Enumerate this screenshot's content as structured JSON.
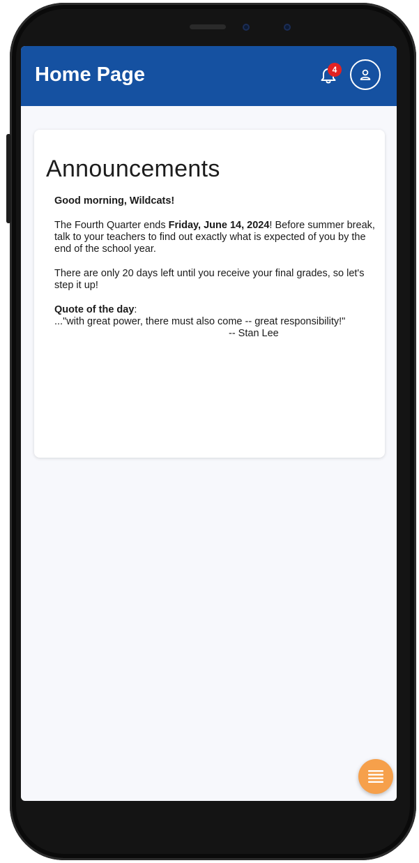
{
  "header": {
    "title": "Home Page",
    "notification_count": "4",
    "bell_icon": "bell-icon",
    "avatar_icon": "user-icon",
    "color": "#1551a1"
  },
  "announcements": {
    "title": "Announcements",
    "greeting": "Good morning, Wildcats!",
    "para1": {
      "before": "The Fourth Quarter ends ",
      "date": "Friday, June 14, 2024",
      "after": "! Before summer break, talk to your teachers to find out exactly what is expected of you by the end of the school year."
    },
    "para2": "There are only 20 days left until you receive your final grades, so let's step it up!",
    "quote": {
      "label": "Quote of the day",
      "separator": ":",
      "text": "...\"with great power, there must also come -- great responsibility!\"",
      "attribution": "-- Stan Lee"
    }
  },
  "fab": {
    "icon": "menu-icon",
    "color": "#f6a04b"
  }
}
